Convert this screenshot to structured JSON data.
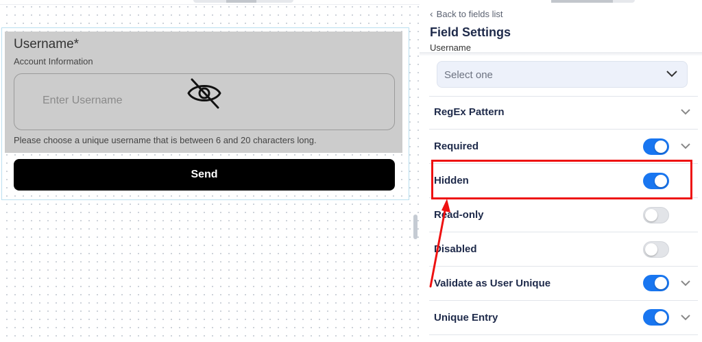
{
  "canvas": {
    "field": {
      "title": "Username*",
      "section": "Account Information",
      "placeholder": "Enter Username",
      "help": "Please choose a unique username that is between 6 and 20 characters long."
    },
    "send_label": "Send"
  },
  "panel": {
    "back_label": "Back to fields list",
    "title": "Field Settings",
    "subtitle": "Username",
    "select_value": "Select one",
    "rows": [
      {
        "label": "RegEx Pattern",
        "toggle": null,
        "expandable": true
      },
      {
        "label": "Required",
        "toggle": "on",
        "expandable": true
      },
      {
        "label": "Hidden",
        "toggle": "on",
        "expandable": false
      },
      {
        "label": "Read-only",
        "toggle": "off",
        "expandable": false
      },
      {
        "label": "Disabled",
        "toggle": "off",
        "expandable": false
      },
      {
        "label": "Validate as User Unique",
        "toggle": "on",
        "expandable": true
      },
      {
        "label": "Unique Entry",
        "toggle": "on",
        "expandable": true
      }
    ]
  },
  "colors": {
    "toggle_on": "#1976f0",
    "annotation": "#ee1111",
    "heading": "#1e2a4a"
  },
  "icons": [
    "eye-off-icon",
    "chevron-left-icon",
    "chevron-down-icon",
    "annotation-arrow"
  ]
}
